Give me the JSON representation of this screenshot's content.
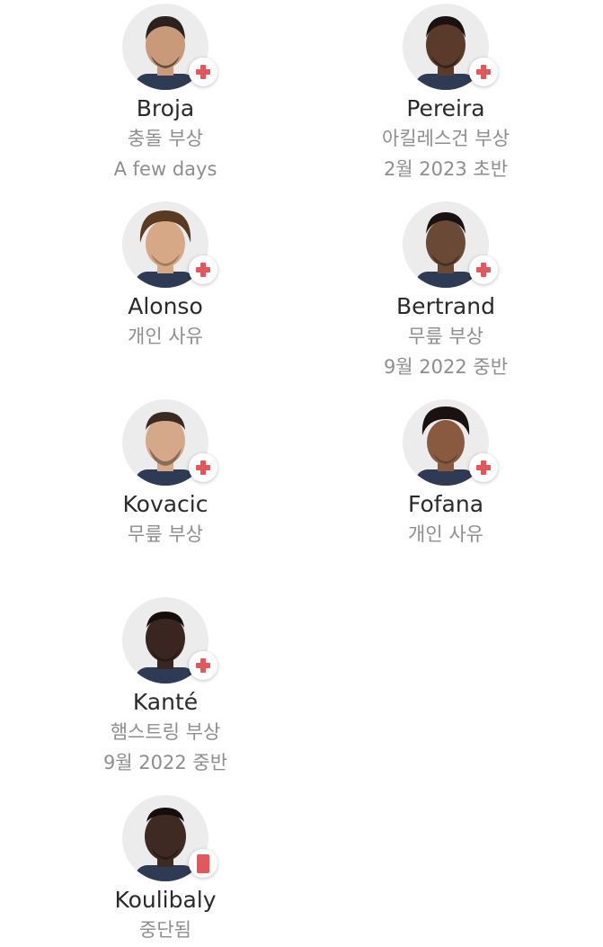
{
  "players": [
    {
      "name": "Broja",
      "reason": "충돌 부상",
      "return": "A few days",
      "status_icon": "injury-cross-icon",
      "skin": "#c99a7a",
      "hair": "#2b2220",
      "beard": "#3a2a22"
    },
    {
      "name": "Pereira",
      "reason": "아킬레스건 부상",
      "return": "2월 2023 초반",
      "status_icon": "injury-cross-icon",
      "skin": "#5a3a2a",
      "hair": "#1a1210",
      "beard": "#1a1210"
    },
    {
      "name": "Alonso",
      "reason": "개인 사유",
      "return": "",
      "status_icon": "injury-cross-icon",
      "skin": "#d6a886",
      "hair": "#5a3a22",
      "beard": "#6b4a30"
    },
    {
      "name": "Bertrand",
      "reason": "무릎 부상",
      "return": "9월 2022 중반",
      "status_icon": "injury-cross-icon",
      "skin": "#6a4a36",
      "hair": "#1a1210",
      "beard": "#2a1e18"
    },
    {
      "name": "Kovacic",
      "reason": "무릎 부상",
      "return": "",
      "status_icon": "injury-cross-icon",
      "skin": "#d6a88a",
      "hair": "#3a2a22",
      "beard": "#4a3a30"
    },
    {
      "name": "Fofana",
      "reason": "개인 사유",
      "return": "",
      "status_icon": "injury-cross-icon",
      "skin": "#8a5a40",
      "hair": "#1a1210",
      "beard": "#2a1e18"
    },
    {
      "name": "Kanté",
      "reason": "햄스트링 부상",
      "return": "9월 2022 중반",
      "status_icon": "injury-cross-icon",
      "skin": "#3a2620",
      "hair": "#140e0c",
      "beard": "#140e0c"
    },
    {
      "name": "Koulibaly",
      "reason": "중단됨",
      "return": "",
      "status_icon": "red-card-icon",
      "skin": "#3e2a22",
      "hair": "#140e0c",
      "beard": "#140e0c"
    }
  ],
  "colors": {
    "badge_red": "#e3575c",
    "name_text": "#2a2a2a",
    "detail_text": "#8e8e8e",
    "avatar_bg": "#ececec"
  }
}
